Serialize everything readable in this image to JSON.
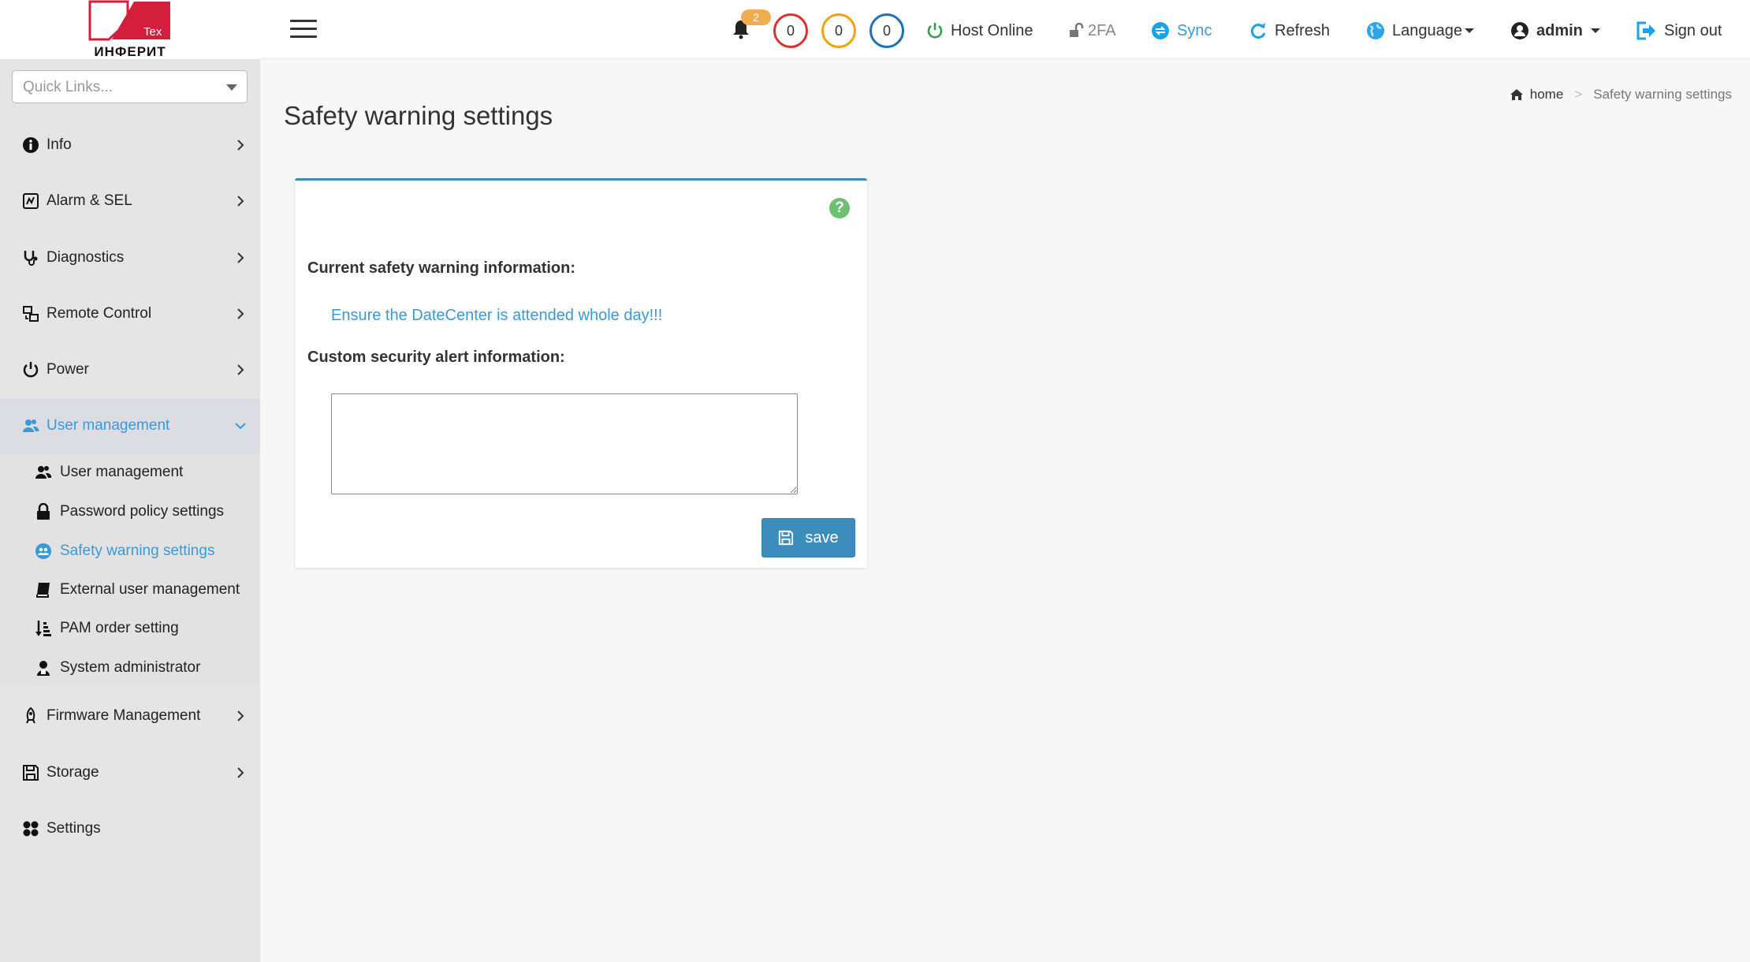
{
  "brand": {
    "logo_text": "ИНФЕРИТ",
    "logo_mark_text": "Tex",
    "logo_color": "#d31f3c"
  },
  "quick_links": {
    "placeholder": "Quick Links..."
  },
  "sidebar": {
    "items": [
      {
        "label": "Info",
        "icon": "info-icon"
      },
      {
        "label": "Alarm & SEL",
        "icon": "alarm-icon"
      },
      {
        "label": "Diagnostics",
        "icon": "stethoscope-icon"
      },
      {
        "label": "Remote Control",
        "icon": "remote-control-icon"
      },
      {
        "label": "Power",
        "icon": "power-icon"
      },
      {
        "label": "User management",
        "icon": "users-icon",
        "active": true
      },
      {
        "label": "Firmware Management",
        "icon": "rocket-icon"
      },
      {
        "label": "Storage",
        "icon": "floppy-icon"
      },
      {
        "label": "Settings",
        "icon": "settings-icon"
      }
    ],
    "submenu": [
      {
        "label": "User management",
        "icon": "users-icon"
      },
      {
        "label": "Password policy settings",
        "icon": "lock-icon"
      },
      {
        "label": "Safety warning settings",
        "icon": "safety-icon",
        "active": true
      },
      {
        "label": "External user management",
        "icon": "book-icon"
      },
      {
        "label": "PAM order setting",
        "icon": "sort-icon"
      },
      {
        "label": "System administrator",
        "icon": "admin-user-icon"
      }
    ]
  },
  "header": {
    "bell_count": "2",
    "counters": [
      {
        "value": "0",
        "color": "#d9322e"
      },
      {
        "value": "0",
        "color": "#f0a30a"
      },
      {
        "value": "0",
        "color": "#1f6fb5"
      }
    ],
    "host_status": "Host Online",
    "twofa": "2FA",
    "sync": "Sync",
    "refresh": "Refresh",
    "language": "Language",
    "user": "admin",
    "signout": "Sign out"
  },
  "breadcrumb": {
    "home": "home",
    "current": "Safety warning settings"
  },
  "page": {
    "title": "Safety warning settings",
    "current_label": "Current safety warning information:",
    "current_value": "Ensure the DateCenter is attended whole day!!!",
    "custom_label": "Custom security alert information:",
    "custom_value": "",
    "save_label": "save"
  },
  "colors": {
    "accent": "#3a99d9",
    "button": "#3c8dbc",
    "help": "#6fbf73",
    "success": "#2e9e3e"
  }
}
